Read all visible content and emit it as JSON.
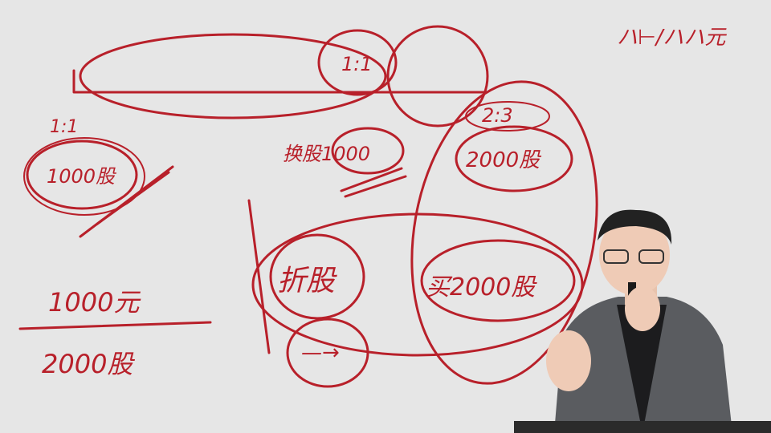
{
  "scene": {
    "description_type": "lecture-whiteboard",
    "ink_color": "#b8202a",
    "board_color": "#e6e6e6"
  },
  "annotations": {
    "top_right": "ハ⊢/ハハ元",
    "left_ratio": "1:1",
    "left_circle": "1000股",
    "center_ratio_top": "1:1",
    "center_label": "换股1000",
    "right_ratio": "2:3",
    "right_circle": "2000股",
    "fraction_numerator": "1000元",
    "fraction_denominator": "2000股",
    "lower_center": "折股",
    "lower_right": "买2000股",
    "arrow_box": "—→"
  }
}
